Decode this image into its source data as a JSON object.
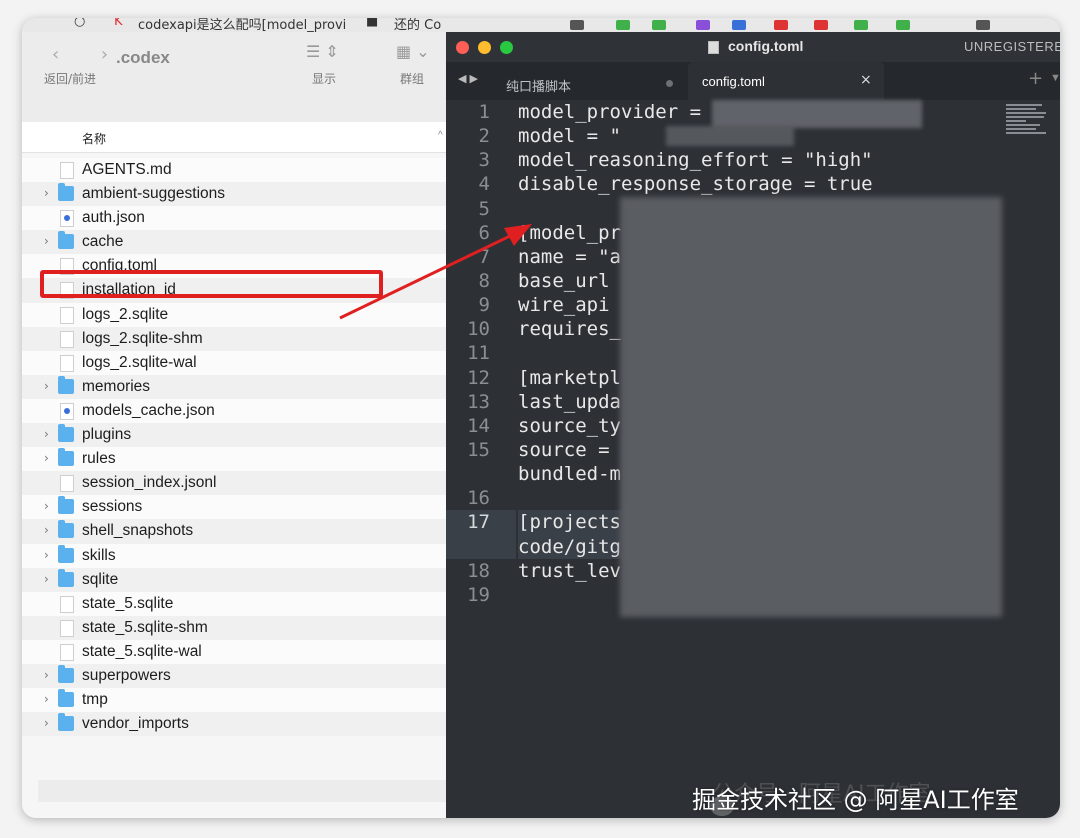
{
  "browser_strip": {
    "tab_text_1": "codexapi是这么配吗[model_provi",
    "tab_text_2": "还的 Co"
  },
  "finder": {
    "nav_label": "返回/前进",
    "folder_title": ".codex",
    "view_label": "显示",
    "group_label": "群组",
    "column_header": "名称",
    "items": [
      {
        "name": "AGENTS.md",
        "type": "doc",
        "expandable": false
      },
      {
        "name": "ambient-suggestions",
        "type": "folder",
        "expandable": true
      },
      {
        "name": "auth.json",
        "type": "json",
        "expandable": false
      },
      {
        "name": "cache",
        "type": "folder",
        "expandable": true
      },
      {
        "name": "config.toml",
        "type": "doc",
        "expandable": false
      },
      {
        "name": "installation_id",
        "type": "doc",
        "expandable": false
      },
      {
        "name": "logs_2.sqlite",
        "type": "doc",
        "expandable": false
      },
      {
        "name": "logs_2.sqlite-shm",
        "type": "doc",
        "expandable": false
      },
      {
        "name": "logs_2.sqlite-wal",
        "type": "doc",
        "expandable": false
      },
      {
        "name": "memories",
        "type": "folder",
        "expandable": true
      },
      {
        "name": "models_cache.json",
        "type": "json",
        "expandable": false
      },
      {
        "name": "plugins",
        "type": "folder",
        "expandable": true
      },
      {
        "name": "rules",
        "type": "folder",
        "expandable": true
      },
      {
        "name": "session_index.jsonl",
        "type": "doc",
        "expandable": false
      },
      {
        "name": "sessions",
        "type": "folder",
        "expandable": true
      },
      {
        "name": "shell_snapshots",
        "type": "folder",
        "expandable": true
      },
      {
        "name": "skills",
        "type": "folder",
        "expandable": true
      },
      {
        "name": "sqlite",
        "type": "folder",
        "expandable": true
      },
      {
        "name": "state_5.sqlite",
        "type": "doc",
        "expandable": false
      },
      {
        "name": "state_5.sqlite-shm",
        "type": "doc",
        "expandable": false
      },
      {
        "name": "state_5.sqlite-wal",
        "type": "doc",
        "expandable": false
      },
      {
        "name": "superpowers",
        "type": "folder",
        "expandable": true
      },
      {
        "name": "tmp",
        "type": "folder",
        "expandable": true
      },
      {
        "name": "vendor_imports",
        "type": "folder",
        "expandable": true
      }
    ],
    "highlighted_item": "config.toml"
  },
  "editor": {
    "window_title": "config.toml",
    "unregistered": "UNREGISTERE",
    "tabs": [
      {
        "label": "纯口播脚本",
        "active": false
      },
      {
        "label": "config.toml",
        "active": true
      }
    ],
    "current_line": "17",
    "lines": [
      {
        "num": "1",
        "text": "model_provider ="
      },
      {
        "num": "2",
        "text": "model = \""
      },
      {
        "num": "3",
        "text": "model_reasoning_effort = \"high\""
      },
      {
        "num": "4",
        "text": "disable_response_storage = true"
      },
      {
        "num": "5",
        "text": ""
      },
      {
        "num": "6",
        "text": "[model_pr"
      },
      {
        "num": "7",
        "text": "name = \"a"
      },
      {
        "num": "8",
        "text": "base_url"
      },
      {
        "num": "9",
        "text": "wire_api"
      },
      {
        "num": "10",
        "text": "requires_"
      },
      {
        "num": "11",
        "text": ""
      },
      {
        "num": "12",
        "text": "[marketpl"
      },
      {
        "num": "13",
        "text": "last_upda"
      },
      {
        "num": "14",
        "text": "source_ty"
      },
      {
        "num": "15",
        "text": "source ="
      },
      {
        "num": "",
        "text": "bundled-m"
      },
      {
        "num": "16",
        "text": ""
      },
      {
        "num": "17",
        "text": "[projects"
      },
      {
        "num": "",
        "text": "code/gitg"
      },
      {
        "num": "18",
        "text": "trust_lev"
      },
      {
        "num": "19",
        "text": ""
      }
    ]
  },
  "watermark": {
    "text": "掘金技术社区 @ 阿星AI工作室",
    "back_text": "公众号 · 阿星AI工作室"
  },
  "colors": {
    "highlight_red": "#e02020",
    "folder_blue": "#5ab1ee",
    "editor_bg": "#2d3136"
  }
}
